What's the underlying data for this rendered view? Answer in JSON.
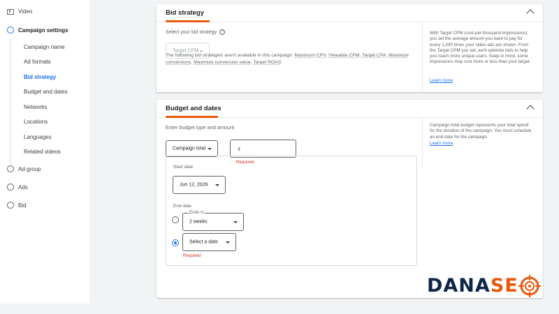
{
  "sidebar": {
    "video": "Video",
    "campaign_settings": "Campaign settings",
    "sub_items": [
      "Campaign name",
      "Ad formats",
      "Bid strategy",
      "Budget and dates",
      "Networks",
      "Locations",
      "Languages",
      "Related videos"
    ],
    "active_sub_item": "Bid strategy",
    "ad_group": "Ad group",
    "ads": "Ads",
    "bid": "Bid"
  },
  "bid_strategy": {
    "title": "Bid strategy",
    "select_label": "Select your bid strategy",
    "help_glyph": "?",
    "selected_value": "Target CPM",
    "unavailable_prefix": "The following bid strategies aren't available in this campaign: ",
    "unavailable_items": [
      "Maximum CPV",
      "Viewable CPM",
      "Target CPA",
      "Maximize conversions",
      "Maximize conversion value",
      "Target ROAS"
    ],
    "aside_text": "With Target CPM (cost-per-thousand impressions), you set the average amount you want to pay for every 1,000 times your video ads are shown. From the Target CPM you set, we'll optimize bids to help you reach more unique users. Keep in mind, some impressions may cost more or less than your target.",
    "learn_more": "Learn more"
  },
  "budget": {
    "title": "Budget and dates",
    "enter_label": "Enter budget type and amount",
    "budget_type": "Campaign total",
    "currency_symbol": "₫",
    "amount_value": "",
    "required": "Required",
    "aside_text": "Campaign total budget represents your total spend for the duration of the campaign. You must schedule an end date for the campaign.",
    "learn_more": "Learn more",
    "start_date_label": "Start date",
    "start_date": "Jun 12, 2026",
    "end_date_label": "End date",
    "ends_in_label": "Ends in",
    "ends_in_value": "2 weeks",
    "select_date": "Select a date",
    "selected_end_option": "select-date"
  },
  "logo": {
    "part1": "DANA",
    "part2": "SE",
    "part3": "O"
  },
  "colors": {
    "accent": "#e8590c",
    "link": "#1a73e8",
    "error": "#d93025",
    "logo_dark": "#0f2547"
  }
}
